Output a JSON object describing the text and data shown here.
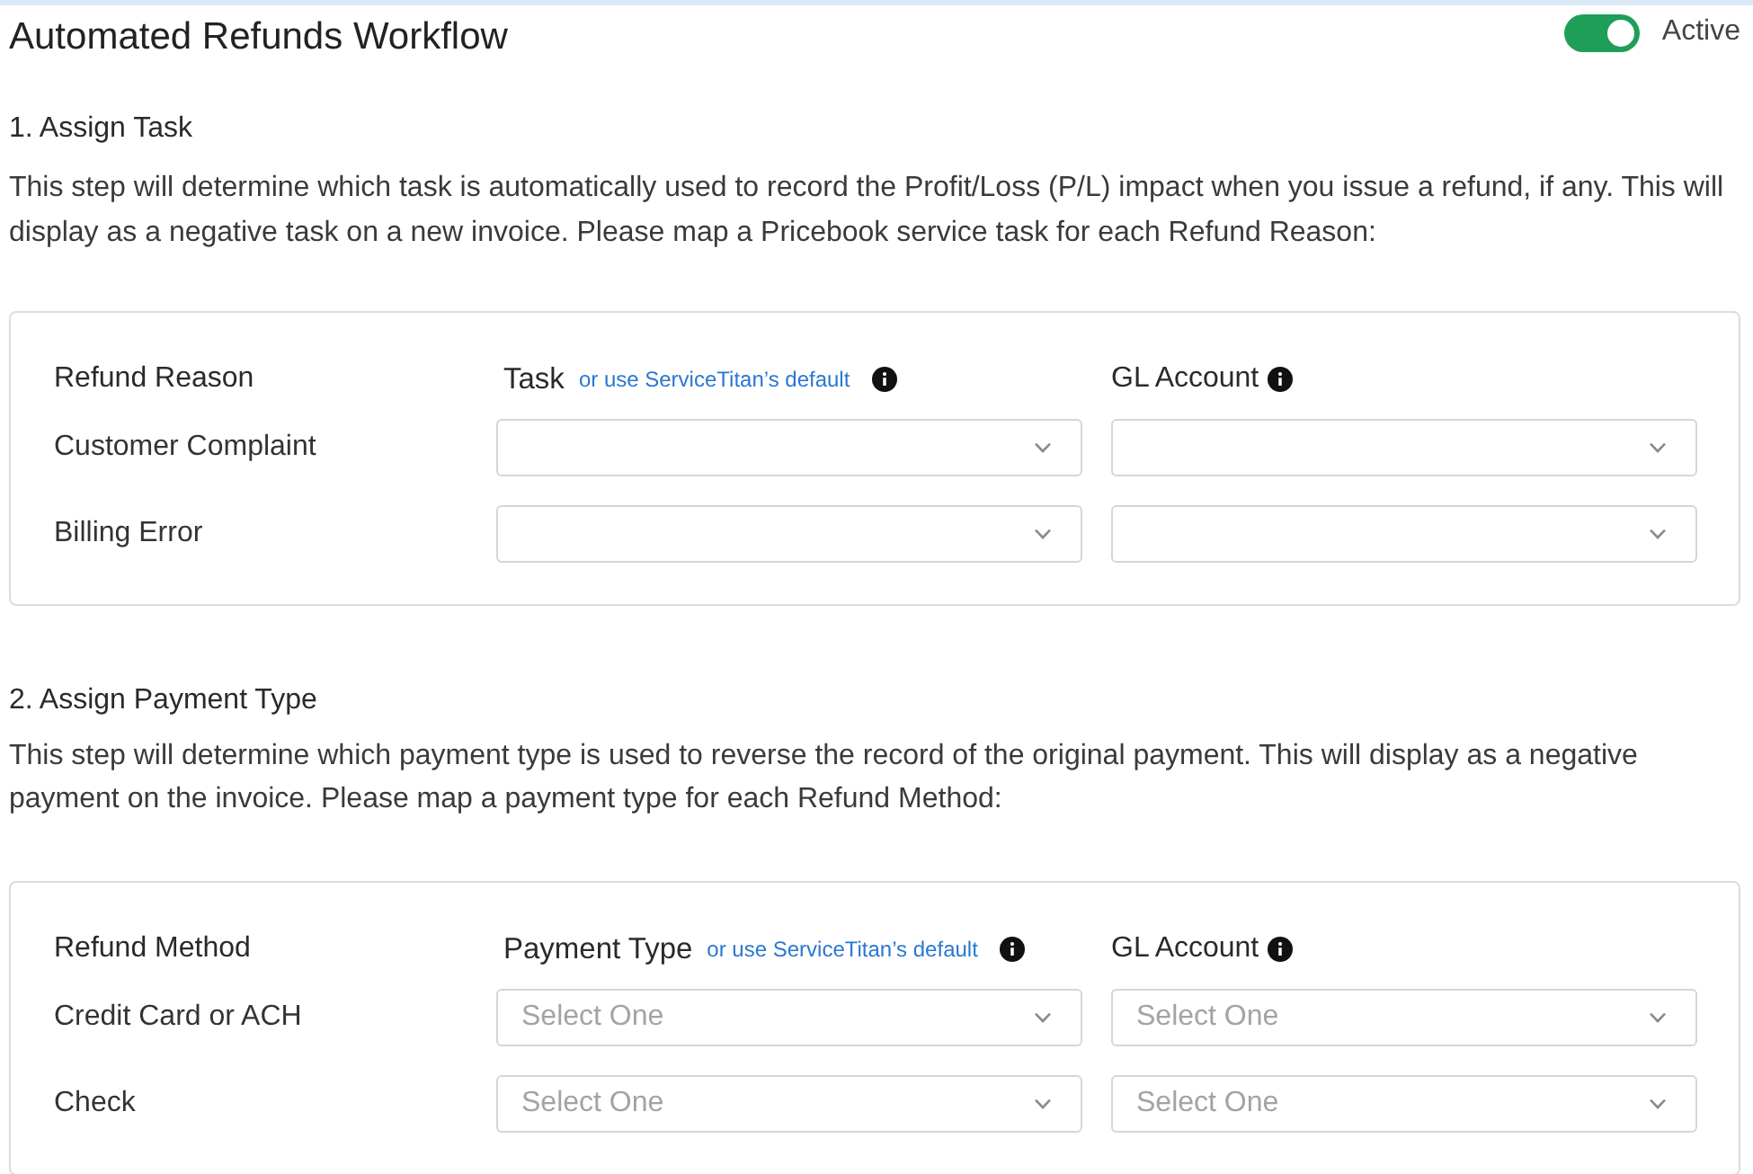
{
  "header": {
    "title": "Automated Refunds Workflow",
    "status_toggle": {
      "on": true,
      "label": "Active"
    }
  },
  "sections": [
    {
      "heading": "1. Assign Task",
      "description": "This step will determine which task is automatically used to record the Profit/Loss (P/L) impact when you issue a refund, if any. This will display as a negative task on a new invoice. Please map a Pricebook service task for each Refund Reason:",
      "table": {
        "columns": [
          {
            "label": "Refund Reason",
            "info": false
          },
          {
            "label": "Task",
            "link": "or use ServiceTitan’s default",
            "info": true
          },
          {
            "label": "GL Account",
            "info": true
          }
        ],
        "rows": [
          {
            "label": "Customer Complaint",
            "fields": [
              {
                "kind": "dropdown"
              },
              {
                "kind": "dropdown"
              }
            ]
          },
          {
            "label": "Billing Error",
            "fields": [
              {
                "kind": "dropdown"
              },
              {
                "kind": "dropdown"
              }
            ]
          }
        ]
      }
    },
    {
      "heading": "2. Assign Payment Type",
      "description": "This step will determine which payment type is used to reverse the record of the original payment. This will display as a negative payment on the invoice. Please map a payment type for each Refund Method:",
      "table": {
        "columns": [
          {
            "label": "Refund Method",
            "info": false
          },
          {
            "label": "Payment Type",
            "link": "or use ServiceTitan’s default",
            "info": true
          },
          {
            "label": "GL Account",
            "info": true
          }
        ],
        "rows": [
          {
            "label": "Credit Card or ACH",
            "fields": [
              {
                "kind": "dropdown",
                "placeholder": "Select One"
              },
              {
                "kind": "dropdown",
                "placeholder": "Select One"
              }
            ]
          },
          {
            "label": "Check",
            "fields": [
              {
                "kind": "dropdown",
                "placeholder": "Select One"
              },
              {
                "kind": "dropdown",
                "placeholder": "Select One"
              }
            ]
          }
        ]
      }
    }
  ]
}
